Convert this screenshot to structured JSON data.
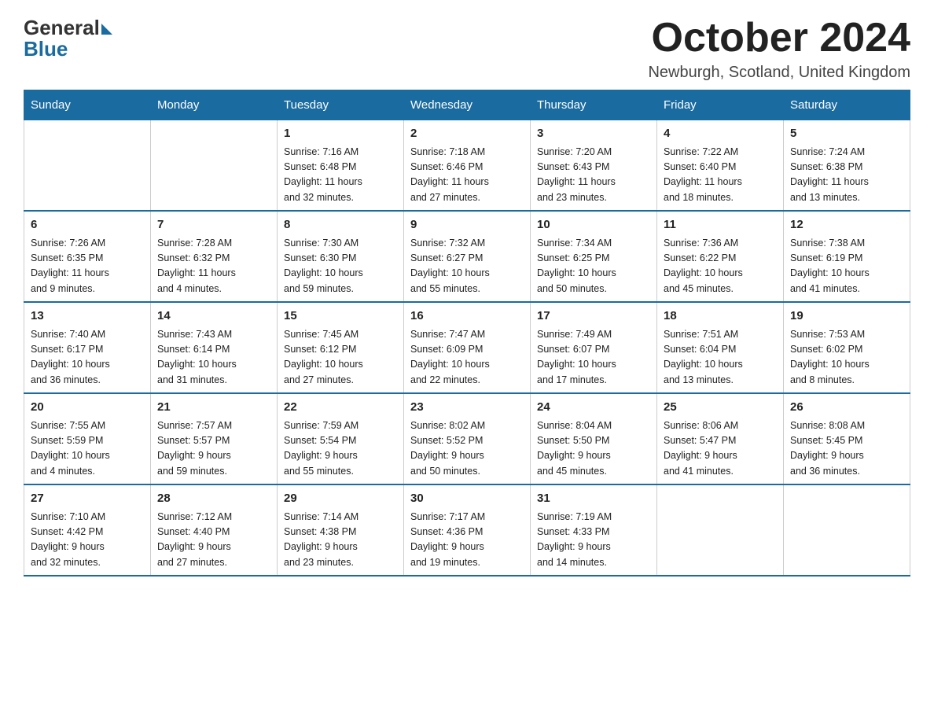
{
  "logo": {
    "general": "General",
    "blue": "Blue"
  },
  "title": "October 2024",
  "location": "Newburgh, Scotland, United Kingdom",
  "days_of_week": [
    "Sunday",
    "Monday",
    "Tuesday",
    "Wednesday",
    "Thursday",
    "Friday",
    "Saturday"
  ],
  "weeks": [
    [
      {
        "day": "",
        "info": ""
      },
      {
        "day": "",
        "info": ""
      },
      {
        "day": "1",
        "info": "Sunrise: 7:16 AM\nSunset: 6:48 PM\nDaylight: 11 hours\nand 32 minutes."
      },
      {
        "day": "2",
        "info": "Sunrise: 7:18 AM\nSunset: 6:46 PM\nDaylight: 11 hours\nand 27 minutes."
      },
      {
        "day": "3",
        "info": "Sunrise: 7:20 AM\nSunset: 6:43 PM\nDaylight: 11 hours\nand 23 minutes."
      },
      {
        "day": "4",
        "info": "Sunrise: 7:22 AM\nSunset: 6:40 PM\nDaylight: 11 hours\nand 18 minutes."
      },
      {
        "day": "5",
        "info": "Sunrise: 7:24 AM\nSunset: 6:38 PM\nDaylight: 11 hours\nand 13 minutes."
      }
    ],
    [
      {
        "day": "6",
        "info": "Sunrise: 7:26 AM\nSunset: 6:35 PM\nDaylight: 11 hours\nand 9 minutes."
      },
      {
        "day": "7",
        "info": "Sunrise: 7:28 AM\nSunset: 6:32 PM\nDaylight: 11 hours\nand 4 minutes."
      },
      {
        "day": "8",
        "info": "Sunrise: 7:30 AM\nSunset: 6:30 PM\nDaylight: 10 hours\nand 59 minutes."
      },
      {
        "day": "9",
        "info": "Sunrise: 7:32 AM\nSunset: 6:27 PM\nDaylight: 10 hours\nand 55 minutes."
      },
      {
        "day": "10",
        "info": "Sunrise: 7:34 AM\nSunset: 6:25 PM\nDaylight: 10 hours\nand 50 minutes."
      },
      {
        "day": "11",
        "info": "Sunrise: 7:36 AM\nSunset: 6:22 PM\nDaylight: 10 hours\nand 45 minutes."
      },
      {
        "day": "12",
        "info": "Sunrise: 7:38 AM\nSunset: 6:19 PM\nDaylight: 10 hours\nand 41 minutes."
      }
    ],
    [
      {
        "day": "13",
        "info": "Sunrise: 7:40 AM\nSunset: 6:17 PM\nDaylight: 10 hours\nand 36 minutes."
      },
      {
        "day": "14",
        "info": "Sunrise: 7:43 AM\nSunset: 6:14 PM\nDaylight: 10 hours\nand 31 minutes."
      },
      {
        "day": "15",
        "info": "Sunrise: 7:45 AM\nSunset: 6:12 PM\nDaylight: 10 hours\nand 27 minutes."
      },
      {
        "day": "16",
        "info": "Sunrise: 7:47 AM\nSunset: 6:09 PM\nDaylight: 10 hours\nand 22 minutes."
      },
      {
        "day": "17",
        "info": "Sunrise: 7:49 AM\nSunset: 6:07 PM\nDaylight: 10 hours\nand 17 minutes."
      },
      {
        "day": "18",
        "info": "Sunrise: 7:51 AM\nSunset: 6:04 PM\nDaylight: 10 hours\nand 13 minutes."
      },
      {
        "day": "19",
        "info": "Sunrise: 7:53 AM\nSunset: 6:02 PM\nDaylight: 10 hours\nand 8 minutes."
      }
    ],
    [
      {
        "day": "20",
        "info": "Sunrise: 7:55 AM\nSunset: 5:59 PM\nDaylight: 10 hours\nand 4 minutes."
      },
      {
        "day": "21",
        "info": "Sunrise: 7:57 AM\nSunset: 5:57 PM\nDaylight: 9 hours\nand 59 minutes."
      },
      {
        "day": "22",
        "info": "Sunrise: 7:59 AM\nSunset: 5:54 PM\nDaylight: 9 hours\nand 55 minutes."
      },
      {
        "day": "23",
        "info": "Sunrise: 8:02 AM\nSunset: 5:52 PM\nDaylight: 9 hours\nand 50 minutes."
      },
      {
        "day": "24",
        "info": "Sunrise: 8:04 AM\nSunset: 5:50 PM\nDaylight: 9 hours\nand 45 minutes."
      },
      {
        "day": "25",
        "info": "Sunrise: 8:06 AM\nSunset: 5:47 PM\nDaylight: 9 hours\nand 41 minutes."
      },
      {
        "day": "26",
        "info": "Sunrise: 8:08 AM\nSunset: 5:45 PM\nDaylight: 9 hours\nand 36 minutes."
      }
    ],
    [
      {
        "day": "27",
        "info": "Sunrise: 7:10 AM\nSunset: 4:42 PM\nDaylight: 9 hours\nand 32 minutes."
      },
      {
        "day": "28",
        "info": "Sunrise: 7:12 AM\nSunset: 4:40 PM\nDaylight: 9 hours\nand 27 minutes."
      },
      {
        "day": "29",
        "info": "Sunrise: 7:14 AM\nSunset: 4:38 PM\nDaylight: 9 hours\nand 23 minutes."
      },
      {
        "day": "30",
        "info": "Sunrise: 7:17 AM\nSunset: 4:36 PM\nDaylight: 9 hours\nand 19 minutes."
      },
      {
        "day": "31",
        "info": "Sunrise: 7:19 AM\nSunset: 4:33 PM\nDaylight: 9 hours\nand 14 minutes."
      },
      {
        "day": "",
        "info": ""
      },
      {
        "day": "",
        "info": ""
      }
    ]
  ]
}
